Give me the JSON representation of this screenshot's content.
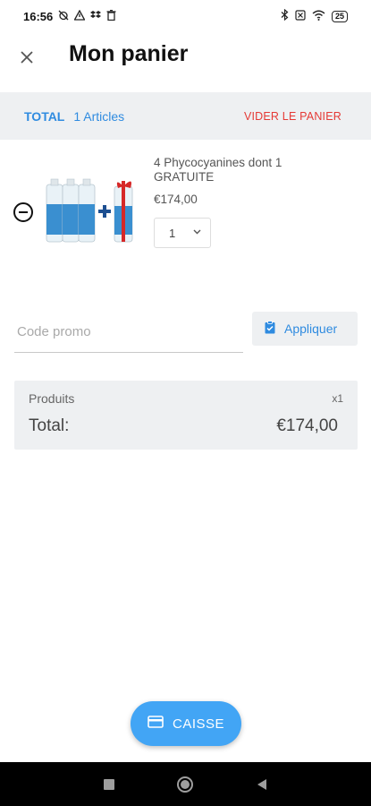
{
  "status_bar": {
    "time": "16:56",
    "battery": "25"
  },
  "header": {
    "title": "Mon panier"
  },
  "total_bar": {
    "label": "TOTAL",
    "count": "1 Articles",
    "empty_cart": "VIDER LE PANIER"
  },
  "cart": {
    "items": [
      {
        "name": "4 Phycocyanines dont 1 GRATUITE",
        "price": "€174,00",
        "quantity": "1"
      }
    ]
  },
  "promo": {
    "placeholder": "Code promo",
    "apply_label": "Appliquer"
  },
  "summary": {
    "products_label": "Produits",
    "quantity": "x1",
    "total_label": "Total:",
    "total_value": "€174,00"
  },
  "checkout": {
    "label": "CAISSE"
  },
  "colors": {
    "accent": "#2f8be0",
    "checkout": "#42a5f5",
    "danger": "#e53935",
    "panel": "#eef0f2"
  }
}
